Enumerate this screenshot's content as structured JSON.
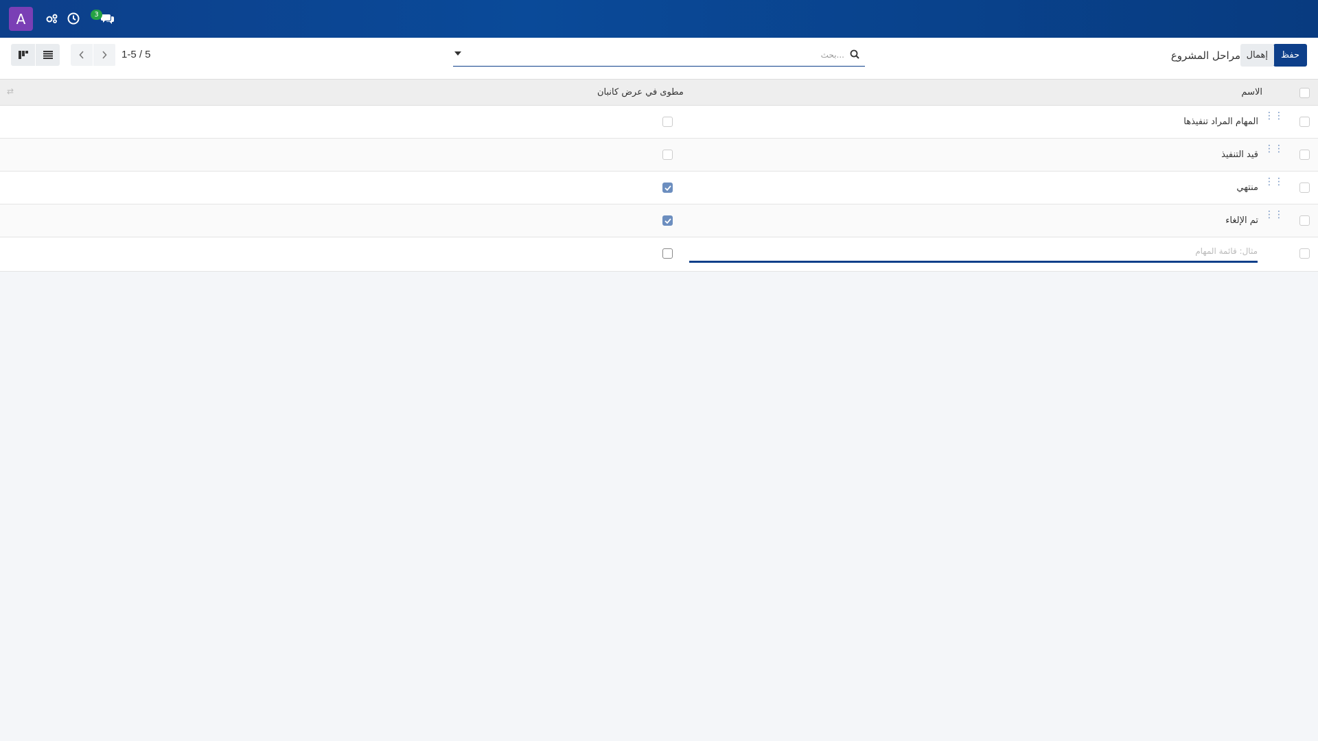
{
  "topbar": {
    "avatar_letter": "A",
    "messages_count": "3",
    "icons": [
      "avatar",
      "activity-settings-icon",
      "clock-icon",
      "chat-icon"
    ]
  },
  "control": {
    "save_label": "حفظ",
    "discard_label": "إهمال",
    "title": "مراحل المشروع",
    "search_placeholder": "بحث...",
    "pager_value": "1-5 / 5"
  },
  "table": {
    "headers": {
      "name": "الاسم",
      "fold": "مطوى في عرض كانبان"
    },
    "rows": [
      {
        "name": "المهام المراد تنفيذها",
        "folded": false
      },
      {
        "name": "قيد التنفيذ",
        "folded": false
      },
      {
        "name": "منتهي",
        "folded": true
      },
      {
        "name": "تم الإلغاء",
        "folded": true
      }
    ],
    "new_row_placeholder": "مثال: قائمة المهام"
  },
  "colors": {
    "brand": "#0d3f8a",
    "accent_purple": "#7a3fb5",
    "badge_green": "#25a244",
    "check": "#6c8ebf"
  }
}
